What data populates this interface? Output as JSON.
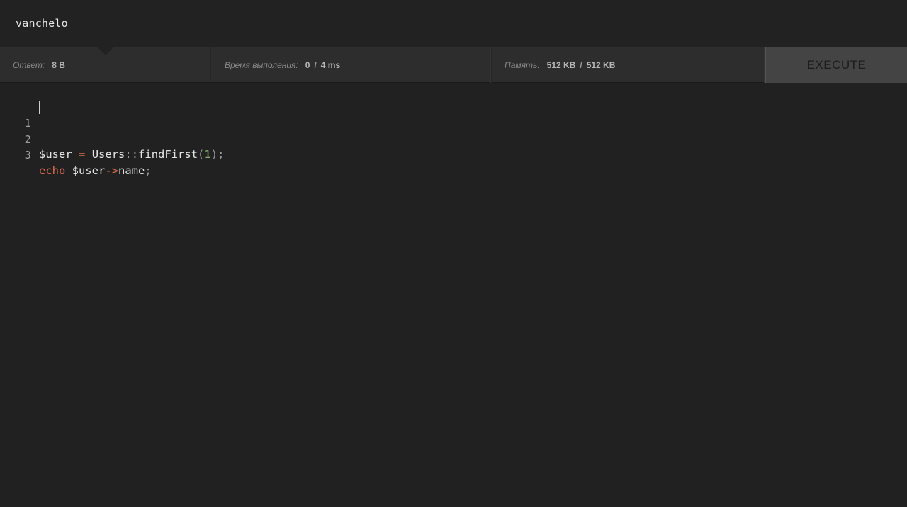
{
  "output": {
    "text": "vanchelo"
  },
  "status": {
    "answer": {
      "label": "Ответ:",
      "value": "8 B"
    },
    "time": {
      "label": "Время выполения:",
      "value": "0",
      "separator": "/",
      "limit": "4 ms"
    },
    "memory": {
      "label": "Память:",
      "value": "512 KB",
      "separator": "/",
      "limit": "512 KB"
    }
  },
  "toolbar": {
    "execute_label": "EXECUTE"
  },
  "editor": {
    "lines": [
      {
        "number": "1",
        "tokens": {
          "var": "$user",
          "sp1": " ",
          "op": "=",
          "sp2": " ",
          "class": "Users",
          "scope": "::",
          "method": "findFirst",
          "lparen": "(",
          "arg": "1",
          "rparen": ")",
          "semi": ";"
        }
      },
      {
        "number": "2",
        "tokens": {}
      },
      {
        "number": "3",
        "tokens": {
          "kw": "echo",
          "sp1": " ",
          "var": "$user",
          "arrow": "->",
          "prop": "name",
          "semi": ";"
        }
      }
    ]
  },
  "colors": {
    "background": "#212121",
    "status_bar": "#2d2d2d",
    "execute_button": "#444444",
    "keyword": "#e06c4f",
    "number": "#7fb36a"
  }
}
